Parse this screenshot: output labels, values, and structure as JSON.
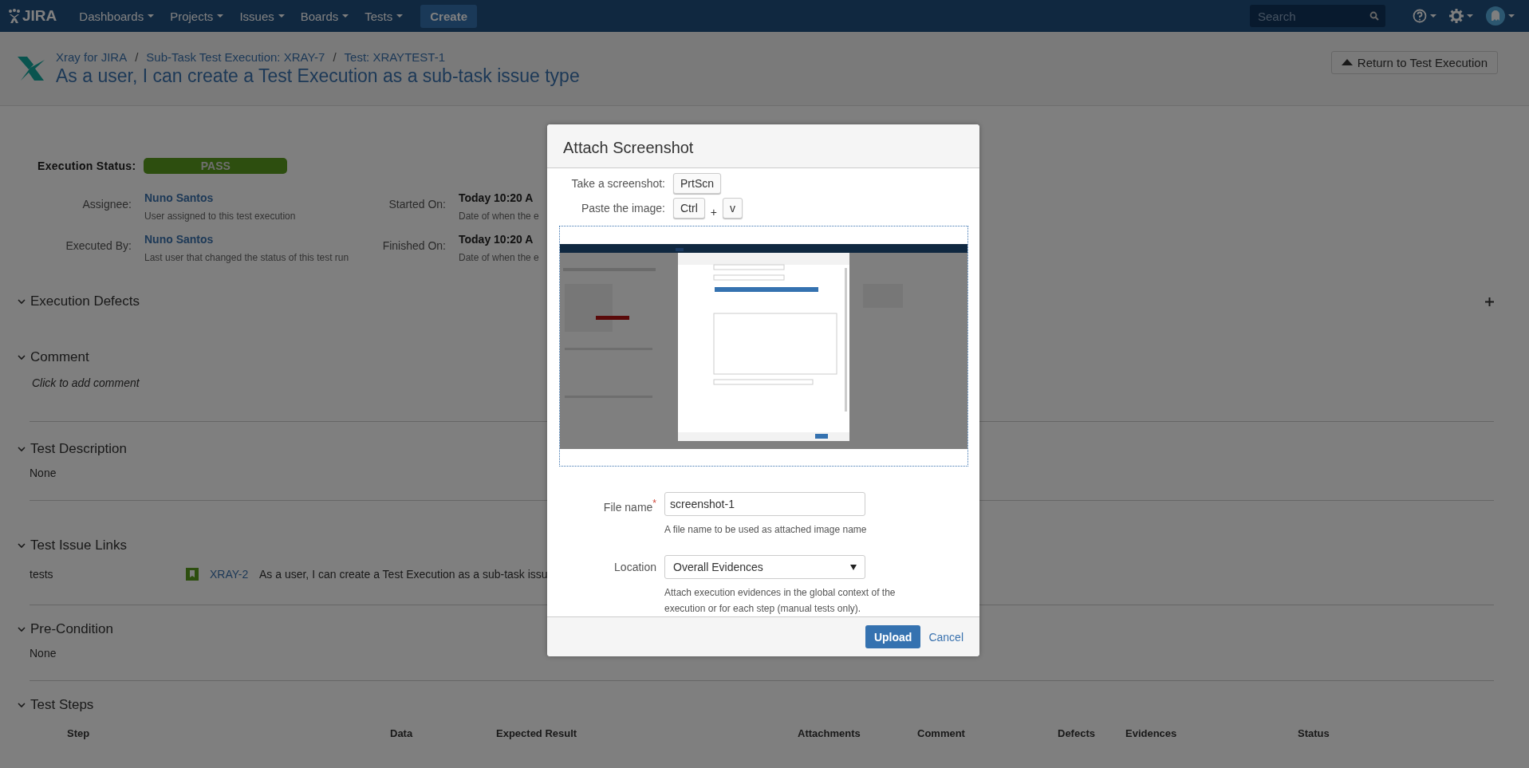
{
  "nav": {
    "logo": "JIRA",
    "menus": [
      {
        "label": "Dashboards"
      },
      {
        "label": "Projects"
      },
      {
        "label": "Issues"
      },
      {
        "label": "Boards"
      },
      {
        "label": "Tests"
      }
    ],
    "create": "Create",
    "search": {
      "placeholder": "Search"
    }
  },
  "header": {
    "breadcrumbs": [
      "Xray for JIRA",
      "Sub-Task Test Execution: XRAY-7",
      "Test: XRAYTEST-1"
    ],
    "separator": "/",
    "title": "As a user, I can create a Test Execution as a sub-task issue type",
    "return_button": "Return to Test Execution"
  },
  "execution": {
    "status_label": "Execution Status:",
    "status": "PASS",
    "fields_left": [
      {
        "label": "Assignee:",
        "value": "Nuno Santos",
        "hint": "User assigned to this test execution"
      },
      {
        "label": "Executed By:",
        "value": "Nuno Santos",
        "hint": "Last user that changed the status of this test run"
      }
    ],
    "fields_right": [
      {
        "label": "Started On:",
        "value": "Today 10:20 A",
        "hint": "Date of when the e"
      },
      {
        "label": "Finished On:",
        "value": "Today 10:20 A",
        "hint": "Date of when the e"
      }
    ]
  },
  "sections": [
    {
      "kind": "defects",
      "title": "Execution Defects",
      "expanded": true
    },
    {
      "kind": "comment",
      "title": "Comment",
      "expanded": true,
      "placeholder": "Click to add comment"
    },
    {
      "kind": "text",
      "title": "Test Description",
      "expanded": true,
      "text": "None"
    },
    {
      "kind": "links",
      "title": "Test Issue Links",
      "expanded": true,
      "links": [
        {
          "relation": "tests",
          "key": "XRAY-2",
          "summary": "As a user, I can create a Test Execution as a sub-task issu"
        }
      ]
    },
    {
      "kind": "text",
      "title": "Pre-Condition",
      "expanded": true,
      "text": "None"
    },
    {
      "kind": "steps",
      "title": "Test Steps",
      "expanded": true,
      "columns": [
        "Step",
        "Data",
        "Expected Result",
        "Attachments",
        "Comment",
        "Defects",
        "Evidences",
        "Status"
      ]
    }
  ],
  "dialog": {
    "title": "Attach Screenshot",
    "shortcuts": [
      {
        "label": "Take a screenshot:",
        "keys": [
          "PrtScn"
        ]
      },
      {
        "label": "Paste the image:",
        "keys": [
          "Ctrl",
          "v"
        ],
        "joiner": "+"
      }
    ],
    "file_name": {
      "label": "File name",
      "required_mark": "*",
      "value": "screenshot-1",
      "hint": "A file name to be used as attached image name"
    },
    "location": {
      "label": "Location",
      "value": "Overall Evidences",
      "hint": "Attach execution evidences in the global context of the execution or for each step (manual tests only)."
    },
    "buttons": {
      "upload": "Upload",
      "cancel": "Cancel"
    }
  }
}
